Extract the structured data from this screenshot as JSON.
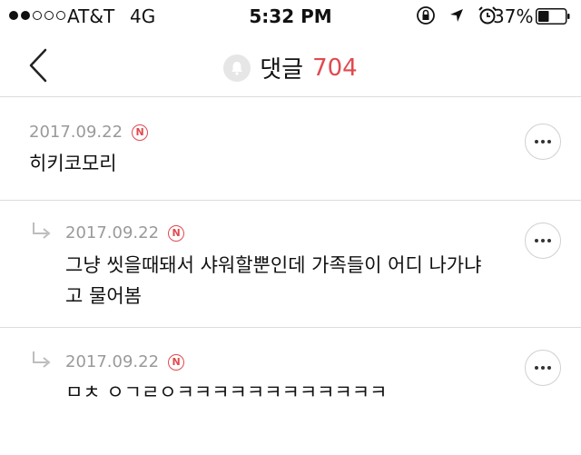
{
  "status_bar": {
    "carrier": "AT&T",
    "network": "4G",
    "time": "5:32 PM",
    "battery_percent": "37%",
    "signal_filled": 2,
    "signal_total": 5
  },
  "header": {
    "back_icon": "chevron-left-icon",
    "bell_icon": "bell-icon",
    "title": "댓글",
    "count": "704",
    "count_color": "#e04a4f"
  },
  "comments": [
    {
      "date": "2017.09.22",
      "badge": "N",
      "text_lines": [
        "히키코모리"
      ],
      "is_reply": false
    },
    {
      "date": "2017.09.22",
      "badge": "N",
      "text_lines": [
        "그냥 씻을때돼서 샤워할뿐인데 가족들이 어디 나가냐",
        "고 물어봄"
      ],
      "is_reply": true
    },
    {
      "date": "2017.09.22",
      "badge": "N",
      "text_lines": [
        "ㅁㅊ ㅇㄱㄹㅇㅋㅋㅋㅋㅋㅋㅋㅋㅋㅋㅋㅋ"
      ],
      "is_reply": true
    }
  ]
}
